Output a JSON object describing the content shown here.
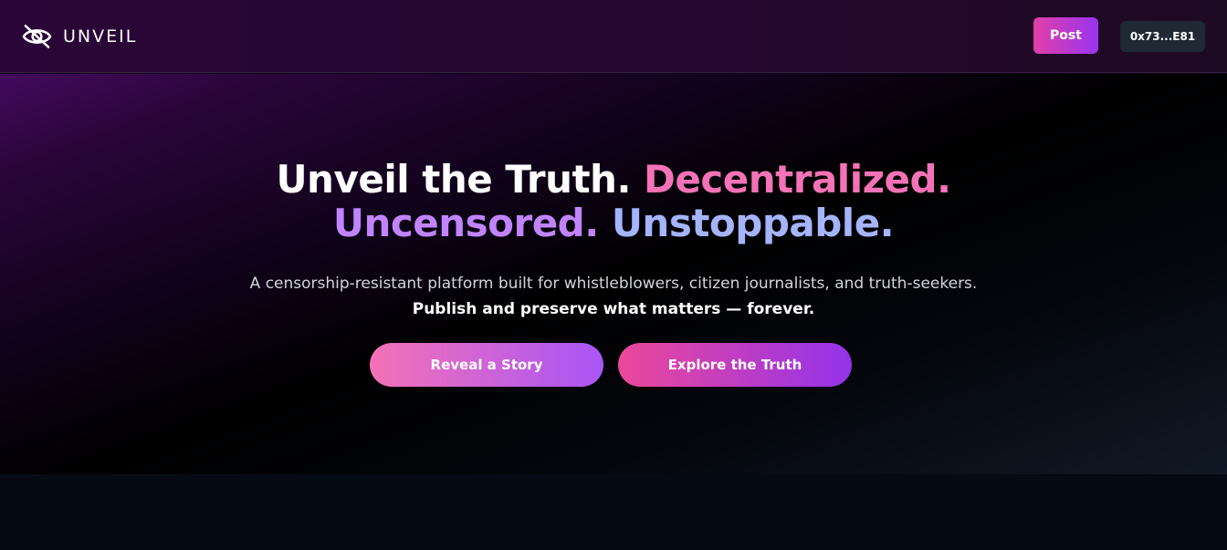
{
  "header": {
    "brand_name": "UNVEIL",
    "brand_icon": "eye-slash-icon",
    "post_label": "Post",
    "wallet_label": "0x73...E81"
  },
  "hero": {
    "headline": {
      "part1": "Unveil the Truth.",
      "part2": "Decentralized.",
      "part3": "Uncensored.",
      "part4": "Unstoppable."
    },
    "subtext": "A censorship-resistant platform built for whistleblowers, citizen journalists, and truth-seekers.",
    "subtext_strong": "Publish and preserve what matters — forever.",
    "primary_cta": "Reveal a Story",
    "secondary_cta": "Explore the Truth"
  },
  "colors": {
    "accent_pink": "#f472b6",
    "accent_purple": "#c084fc",
    "accent_blue": "#a5b4fc",
    "header_bg": "#26062f",
    "page_bg": "#050a14"
  }
}
